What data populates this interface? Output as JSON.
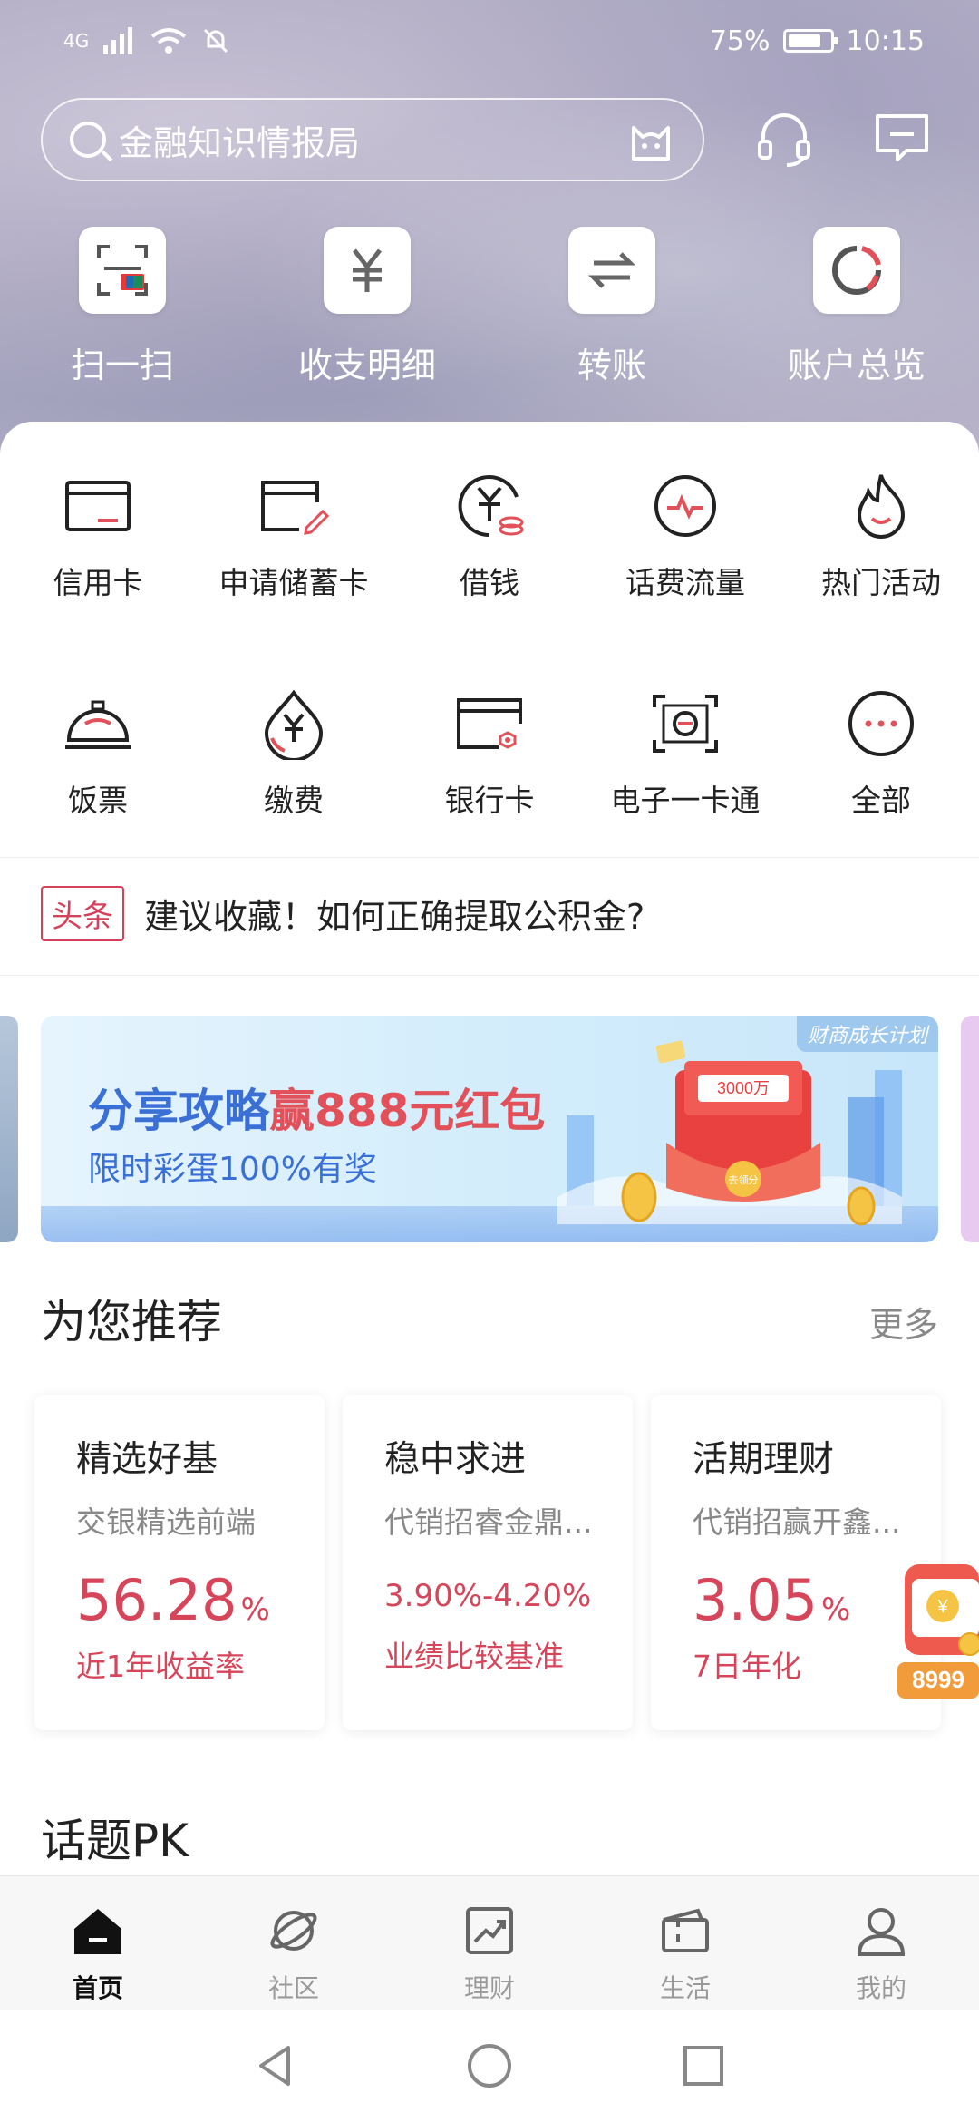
{
  "status": {
    "network": "4G",
    "battery": "75%",
    "time": "10:15"
  },
  "search": {
    "placeholder": "金融知识情报局"
  },
  "quick_actions": [
    {
      "label": "扫一扫",
      "icon": "scan-icon"
    },
    {
      "label": "收支明细",
      "icon": "yuan-icon"
    },
    {
      "label": "转账",
      "icon": "transfer-icon"
    },
    {
      "label": "账户总览",
      "icon": "pie-chart-icon"
    }
  ],
  "services_row1": [
    {
      "label": "信用卡",
      "icon": "credit-card-icon"
    },
    {
      "label": "申请储蓄卡",
      "icon": "apply-card-icon"
    },
    {
      "label": "借钱",
      "icon": "borrow-icon"
    },
    {
      "label": "话费流量",
      "icon": "phone-bill-icon"
    },
    {
      "label": "热门活动",
      "icon": "fire-icon"
    }
  ],
  "services_row2": [
    {
      "label": "饭票",
      "icon": "meal-ticket-icon"
    },
    {
      "label": "缴费",
      "icon": "payment-icon"
    },
    {
      "label": "银行卡",
      "icon": "bank-card-icon"
    },
    {
      "label": "电子一卡通",
      "icon": "e-card-icon"
    },
    {
      "label": "全部",
      "icon": "more-icon"
    }
  ],
  "news": {
    "tag": "头条",
    "text": "建议收藏！如何正确提取公积金?"
  },
  "banner": {
    "badge": "财商成长计划",
    "title_prefix": "分享攻略",
    "title_highlight": "赢888元红包",
    "subtitle": "限时彩蛋100%有奖",
    "envelope_text": "3000万",
    "coin_text": "去领分"
  },
  "recommend": {
    "title": "为您推荐",
    "more": "更多",
    "cards": [
      {
        "title": "精选好基",
        "subtitle": "交银精选前端",
        "value": "56.28",
        "unit": "%",
        "label": "近1年收益率"
      },
      {
        "title": "稳中求进",
        "subtitle": "代销招睿金鼎...",
        "value": "3.90%-4.20%",
        "unit": "",
        "label": "业绩比较基准"
      },
      {
        "title": "活期理财",
        "subtitle": "代销招赢开鑫...",
        "value": "3.05",
        "unit": "%",
        "label": "7日年化"
      }
    ]
  },
  "float_promo": {
    "text": "8999"
  },
  "topic": {
    "title": "话题PK"
  },
  "nav": [
    {
      "label": "首页",
      "active": true
    },
    {
      "label": "社区",
      "active": false
    },
    {
      "label": "理财",
      "active": false
    },
    {
      "label": "生活",
      "active": false
    },
    {
      "label": "我的",
      "active": false
    }
  ],
  "colors": {
    "accent_red": "#d6455a",
    "banner_blue": "#3a6fd6"
  }
}
